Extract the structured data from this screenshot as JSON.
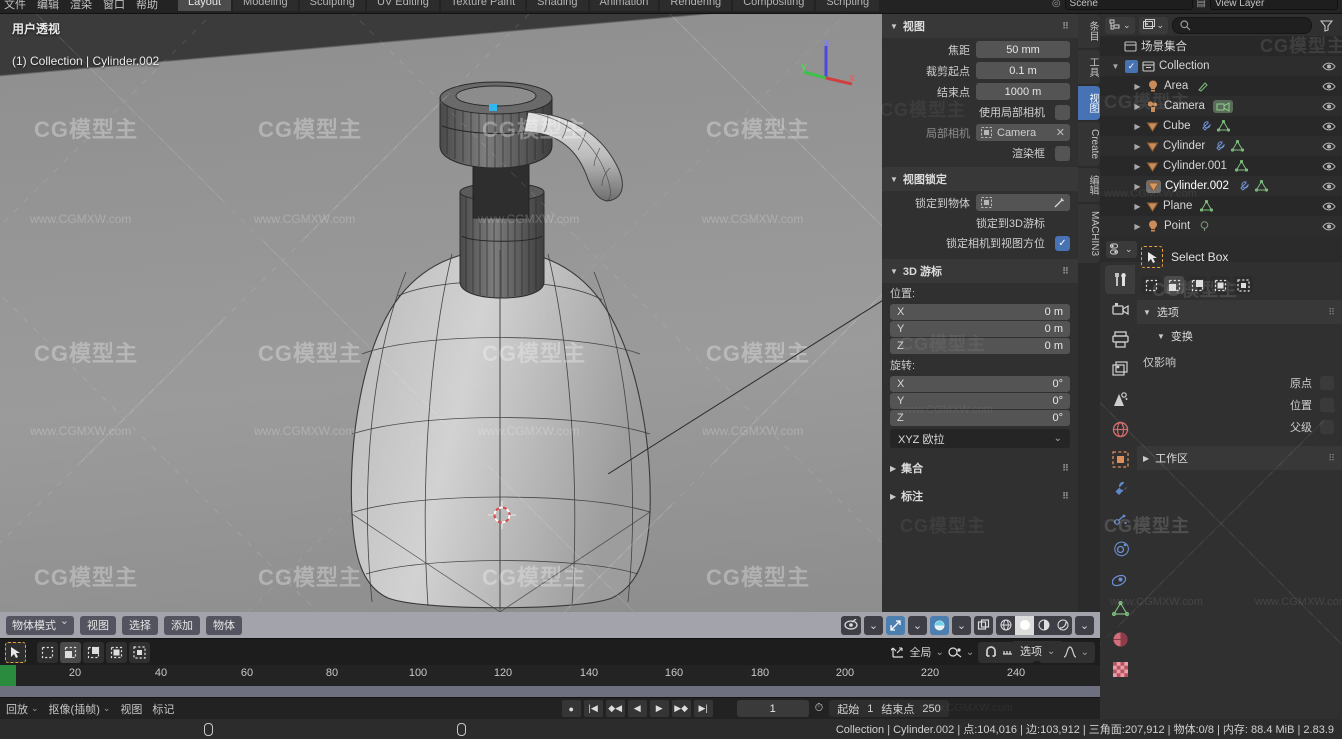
{
  "topbar": {
    "menus": [
      "文件",
      "编辑",
      "渲染",
      "窗口",
      "帮助"
    ],
    "tabs": [
      {
        "label": "Layout",
        "active": true
      },
      {
        "label": "Modeling",
        "active": false
      },
      {
        "label": "Sculpting",
        "active": false
      },
      {
        "label": "UV Editing",
        "active": false
      },
      {
        "label": "Texture Paint",
        "active": false
      },
      {
        "label": "Shading",
        "active": false
      },
      {
        "label": "Animation",
        "active": false
      },
      {
        "label": "Rendering",
        "active": false
      },
      {
        "label": "Compositing",
        "active": false
      },
      {
        "label": "Scripting",
        "active": false
      }
    ],
    "scene_field": "Scene",
    "viewlayer_field": "View Layer"
  },
  "viewport": {
    "perspective_label": "用户透视",
    "object_label": "(1) Collection | Cylinder.002",
    "gizmo_axes": [
      "X",
      "Y",
      "Z"
    ],
    "watermark_logo": "CG模型主",
    "watermark_url": "www.CGMXW.com"
  },
  "viewport_header": {
    "mode": "物体模式",
    "menus": [
      "视图",
      "选择",
      "添加",
      "物体"
    ],
    "gizmo_icon": "eye-gizmo-icon",
    "snap_icon": "magnet-icon",
    "overlay_icon": "overlays-icon",
    "xray_icon": "xray-icon",
    "shading": [
      "wireframe",
      "solid",
      "material",
      "rendered"
    ],
    "shading_active": "solid"
  },
  "tool_header": {
    "active_tool": "select-box",
    "select_modes": [
      "set",
      "extend",
      "subtract",
      "invert",
      "intersect"
    ],
    "transform_orientation": "全局",
    "pivot_icon": "pivot-icon",
    "snap_icon": "snap-magnet-icon",
    "proportional_icon": "proportional-edit-icon",
    "falloff_icon": "falloff-curve-icon",
    "options_label": "选项"
  },
  "timeline": {
    "ticks": [
      20,
      40,
      60,
      80,
      100,
      120,
      140,
      160,
      180,
      200,
      220,
      240
    ],
    "current_frame_marker": 1
  },
  "playbar": {
    "menus": [
      "回放",
      "抠像(插帧)",
      "视图",
      "标记"
    ],
    "menus_with_chevron": [
      "回放",
      "抠像(插帧)"
    ],
    "current_frame": "1",
    "start_label": "起始",
    "start_value": "1",
    "end_label": "结束点",
    "end_value": "250",
    "transport": [
      "record",
      "jump-start",
      "prev-keyframe",
      "play-reverse",
      "play",
      "next-keyframe",
      "jump-end"
    ]
  },
  "statusbar": {
    "text": "Collection | Cylinder.002 | 点:104,016 | 边:103,912 | 三角面:207,912 | 物体:0/8 | 内存: 88.4 MiB | 2.83.9"
  },
  "npanel": {
    "tabs": [
      {
        "label": "条目",
        "active": false
      },
      {
        "label": "工具",
        "active": false
      },
      {
        "label": "视图",
        "active": true
      },
      {
        "label": "Create",
        "active": false
      },
      {
        "label": "编辑",
        "active": false
      },
      {
        "label": "MACHIN3",
        "active": false
      }
    ],
    "view_section": {
      "title": "视图",
      "rows": [
        {
          "label": "焦距",
          "value": "50 mm"
        },
        {
          "label": "裁剪起点",
          "value": "0.1 m"
        },
        {
          "label": "结束点",
          "value": "1000 m"
        }
      ],
      "local_camera_toggle_label": "使用局部相机",
      "local_camera_label": "局部相机",
      "local_camera_value": "Camera",
      "render_region_label": "渲染框"
    },
    "lock_section": {
      "title": "视图锁定",
      "lock_object_label": "锁定到物体",
      "lock_cursor_label": "锁定到3D游标",
      "lock_camera_label": "锁定相机到视图方位",
      "lock_camera_checked": true
    },
    "cursor_section": {
      "title": "3D 游标",
      "position_label": "位置:",
      "position": [
        {
          "axis": "X",
          "value": "0 m"
        },
        {
          "axis": "Y",
          "value": "0 m"
        },
        {
          "axis": "Z",
          "value": "0 m"
        }
      ],
      "rotation_label": "旋转:",
      "rotation": [
        {
          "axis": "X",
          "value": "0°"
        },
        {
          "axis": "Y",
          "value": "0°"
        },
        {
          "axis": "Z",
          "value": "0°"
        }
      ],
      "rotation_mode": "XYZ 欧拉"
    },
    "collections_section": "集合",
    "annotations_section": "标注"
  },
  "outliner": {
    "search_placeholder": "",
    "scene_collection": "场景集合",
    "rows": [
      {
        "name": "Collection",
        "indent": 0,
        "icon": "collection-icon",
        "checkbox": true,
        "expander": "down",
        "mods": [],
        "eye": true
      },
      {
        "name": "Area",
        "indent": 1,
        "icon": "light-icon",
        "mods": [
          "light-data"
        ],
        "eye": true
      },
      {
        "name": "Camera",
        "indent": 1,
        "icon": "camera-icon",
        "mods": [
          "camera-data"
        ],
        "eye": true,
        "highlight_data": true
      },
      {
        "name": "Cube",
        "indent": 1,
        "icon": "mesh-icon",
        "mods": [
          "modifier",
          "mesh-data"
        ],
        "eye": true
      },
      {
        "name": "Cylinder",
        "indent": 1,
        "icon": "mesh-icon",
        "mods": [
          "modifier",
          "mesh-data"
        ],
        "eye": true
      },
      {
        "name": "Cylinder.001",
        "indent": 1,
        "icon": "mesh-icon",
        "mods": [
          "mesh-data"
        ],
        "eye": true
      },
      {
        "name": "Cylinder.002",
        "indent": 1,
        "icon": "mesh-icon",
        "mods": [
          "modifier",
          "mesh-data"
        ],
        "eye": true,
        "selected": true
      },
      {
        "name": "Plane",
        "indent": 1,
        "icon": "mesh-icon",
        "mods": [
          "mesh-data"
        ],
        "eye": true
      },
      {
        "name": "Point",
        "indent": 1,
        "icon": "light-icon",
        "mods": [
          "light-data"
        ],
        "eye": true
      }
    ]
  },
  "properties": {
    "tabs": [
      "tool-icon",
      "render-icon",
      "output-icon",
      "viewlayer-icon",
      "scene-icon",
      "world-icon",
      "object-icon",
      "modifier-icon",
      "particles-icon",
      "physics-icon",
      "constraint-icon",
      "data-icon",
      "material-icon",
      "texture-icon"
    ],
    "active_tab": "tool-icon",
    "tool_name": "Select Box",
    "select_modes": [
      "set",
      "extend",
      "subtract",
      "invert",
      "intersect"
    ],
    "options_section": "选项",
    "transform_section": "变换",
    "affect_only_label": "仅影响",
    "affect_items": [
      "原点",
      "位置",
      "父级"
    ],
    "workspace_section": "工作区"
  }
}
